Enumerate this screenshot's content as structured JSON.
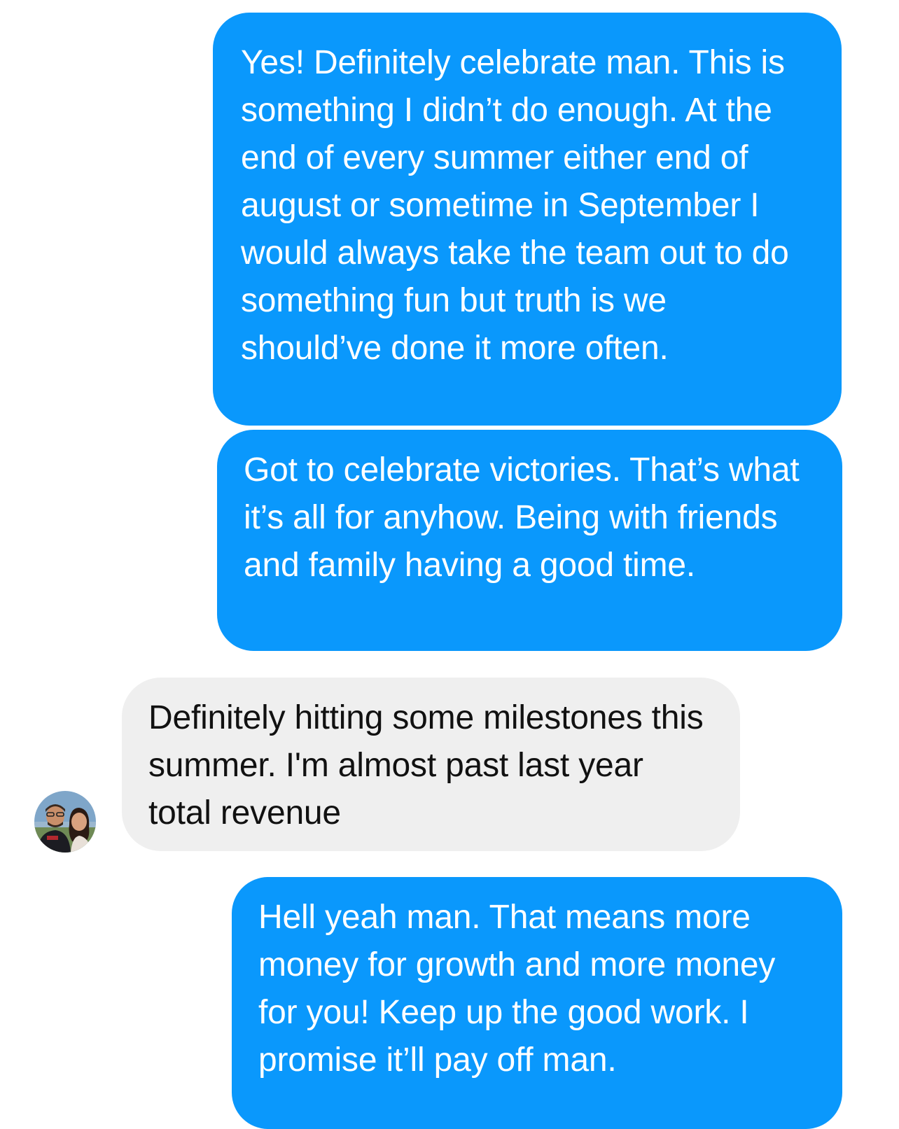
{
  "messages": [
    {
      "direction": "sent",
      "text": "Yes! Definitely celebrate man. This is something I didn’t do enough. At the end of every summer either end of august or sometime in September I would always take the team out to do something fun but truth is we should’ve done it more often."
    },
    {
      "direction": "sent",
      "text": "Got to celebrate victories. That’s what it’s all for anyhow. Being with friends and family having a good time."
    },
    {
      "direction": "received",
      "text": "Definitely hitting some milestones this summer. I'm almost past last year total revenue",
      "avatar_icon": "contact-avatar-photo"
    },
    {
      "direction": "sent",
      "text": "Hell yeah man. That means more money for growth and more money for you! Keep up the good work. I promise it’ll pay off man."
    }
  ],
  "colors": {
    "sent_bubble": "#0a98fc",
    "received_bubble": "#efefef",
    "sent_text": "#ffffff",
    "received_text": "#111111",
    "background": "#ffffff"
  }
}
